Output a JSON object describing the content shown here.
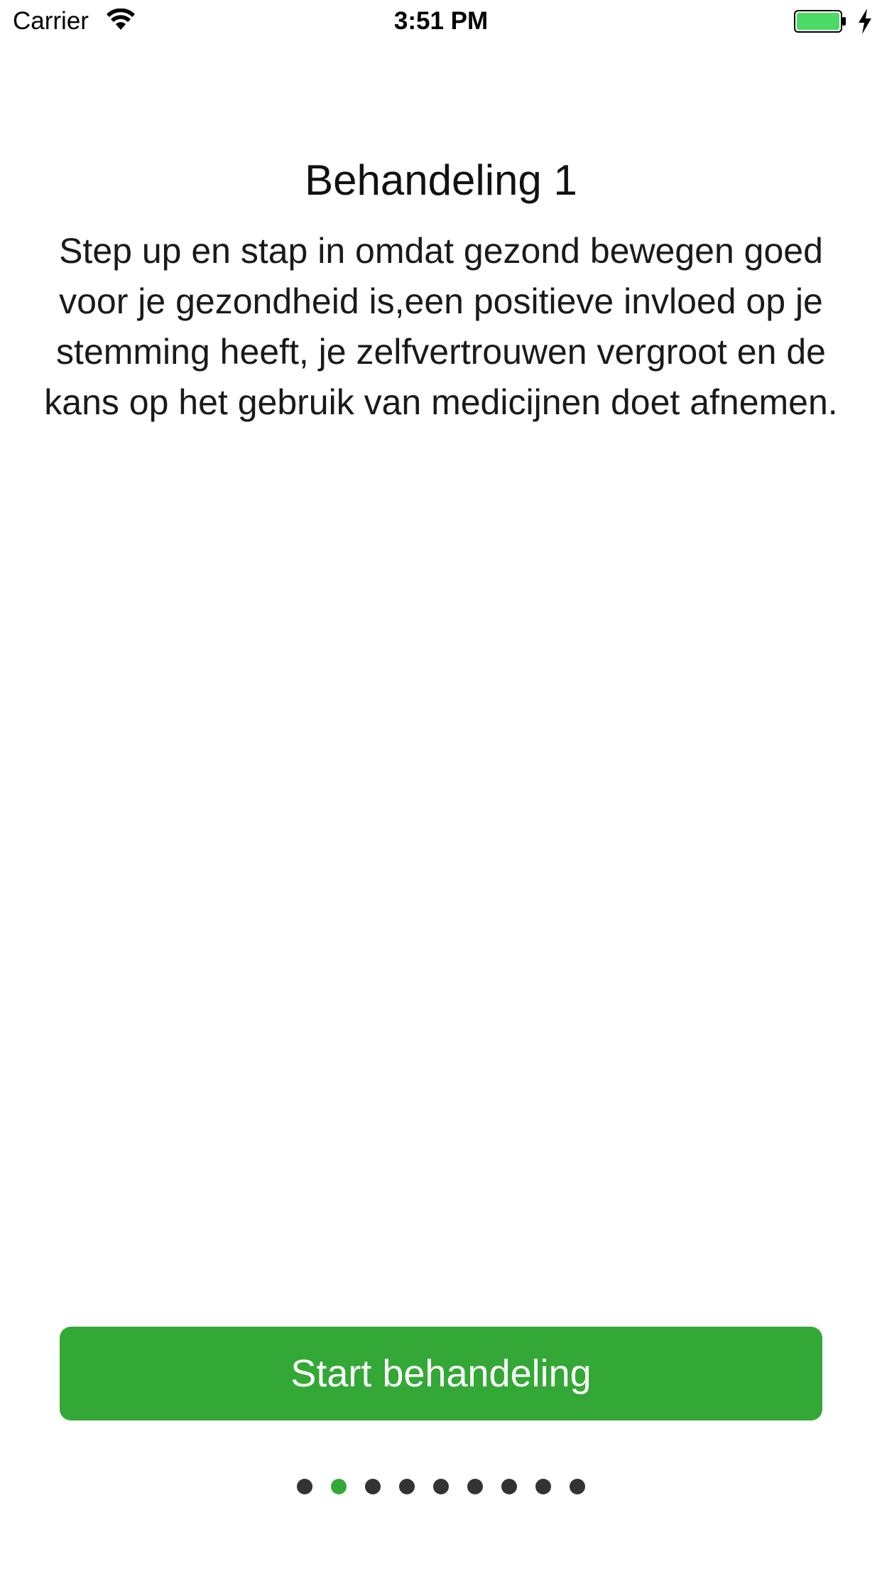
{
  "status_bar": {
    "carrier": "Carrier",
    "time": "3:51 PM",
    "icons": [
      "wifi-icon",
      "battery-icon",
      "charging-bolt-icon"
    ],
    "battery_color": "#4cd964"
  },
  "content": {
    "title": "Behandeling 1",
    "description": "Step up en stap in omdat gezond bewegen goed voor je gezondheid is,een positieve invloed op je stemming heeft, je zelfvertrouwen vergroot en de kans op het gebruik van medicijnen doet afnemen."
  },
  "actions": {
    "start_label": "Start behandeling",
    "accent_color": "#34a836"
  },
  "page_control": {
    "total_pages": 9,
    "current_page": 2
  }
}
